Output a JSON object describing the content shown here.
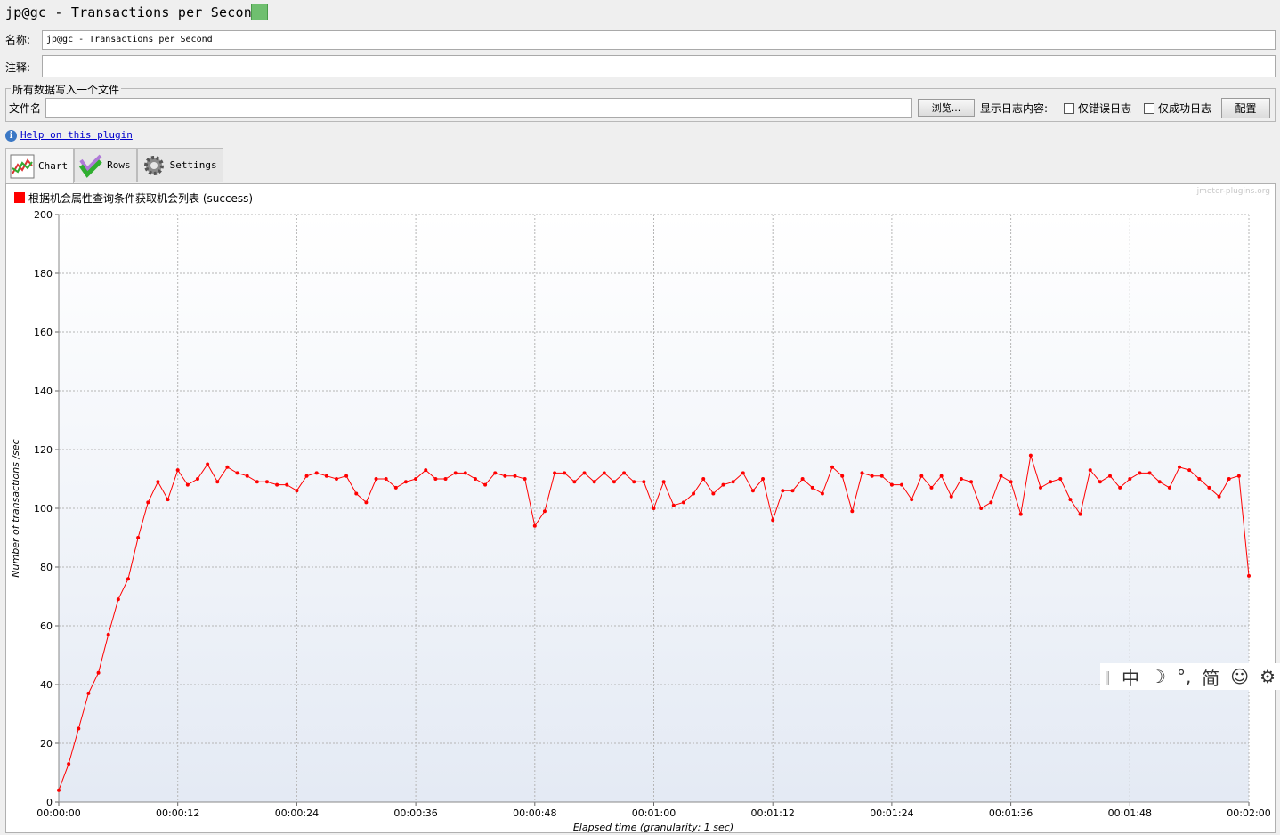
{
  "window_title": "jp@gc - Transactions per Second",
  "name_label": "名称:",
  "name_value": "jp@gc - Transactions per Second",
  "comment_label": "注释:",
  "comment_value": "",
  "file_group_title": "所有数据写入一个文件",
  "filename_label": "文件名",
  "filename_value": "",
  "browse_button": "浏览...",
  "log_display_label": "显示日志内容:",
  "errors_only_label": "仅错误日志",
  "success_only_label": "仅成功日志",
  "config_button": "配置",
  "help_link": "Help on this plugin",
  "tabs": [
    {
      "label": "Chart",
      "icon": "chart-icon"
    },
    {
      "label": "Rows",
      "icon": "checkmark-icon"
    },
    {
      "label": "Settings",
      "icon": "gear-icon"
    }
  ],
  "watermark": "jmeter-plugins.org",
  "ime_bar": {
    "items": [
      "中",
      "☽",
      "°,",
      "简",
      "☺",
      "⚙"
    ]
  },
  "colors": {
    "series": "#ff0000",
    "link": "#0000cc"
  },
  "chart_data": {
    "type": "line",
    "title": "",
    "xlabel": "Elapsed time (granularity: 1 sec)",
    "ylabel": "Number of transactions /sec",
    "ylim": [
      0,
      200
    ],
    "yticks": [
      0,
      20,
      40,
      60,
      80,
      100,
      120,
      140,
      160,
      180,
      200
    ],
    "xlim_sec": [
      0,
      120
    ],
    "xticks": [
      "00:00:00",
      "00:00:12",
      "00:00:24",
      "00:00:36",
      "00:00:48",
      "00:01:00",
      "00:01:12",
      "00:01:24",
      "00:01:36",
      "00:01:48",
      "00:02:00"
    ],
    "grid": true,
    "legend": "top-left",
    "series": [
      {
        "name": "根据机会属性查询条件获取机会列表 (success)",
        "color": "#ff0000",
        "values": [
          4,
          13,
          25,
          37,
          44,
          57,
          69,
          76,
          90,
          102,
          109,
          103,
          113,
          108,
          110,
          115,
          109,
          114,
          112,
          111,
          109,
          109,
          108,
          108,
          106,
          111,
          112,
          111,
          110,
          111,
          105,
          102,
          110,
          110,
          107,
          109,
          110,
          113,
          110,
          110,
          112,
          112,
          110,
          108,
          112,
          111,
          111,
          110,
          94,
          99,
          112,
          112,
          109,
          112,
          109,
          112,
          109,
          112,
          109,
          109,
          100,
          109,
          101,
          102,
          105,
          110,
          105,
          108,
          109,
          112,
          106,
          110,
          96,
          106,
          106,
          110,
          107,
          105,
          114,
          111,
          99,
          112,
          111,
          111,
          108,
          108,
          103,
          111,
          107,
          111,
          104,
          110,
          109,
          100,
          102,
          111,
          109,
          98,
          118,
          107,
          109,
          110,
          103,
          98,
          113,
          109,
          111,
          107,
          110,
          112,
          112,
          109,
          107,
          114,
          113,
          110,
          107,
          104,
          110,
          111,
          77
        ]
      }
    ]
  }
}
